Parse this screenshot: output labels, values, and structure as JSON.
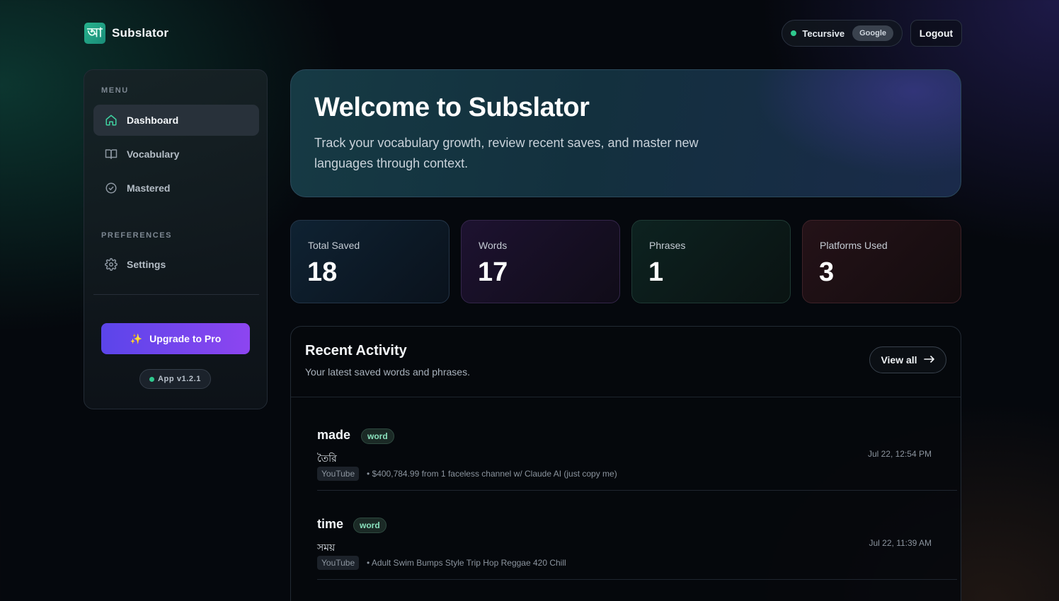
{
  "app": {
    "name": "Subslator",
    "logo_glyph": "আ"
  },
  "header": {
    "user_name": "Tecursive",
    "auth_provider": "Google",
    "logout_label": "Logout",
    "status_color": "#2fc98e"
  },
  "sidebar": {
    "menu_title": "MENU",
    "items": [
      {
        "label": "Dashboard",
        "icon": "home-icon",
        "active": true
      },
      {
        "label": "Vocabulary",
        "icon": "book-icon",
        "active": false
      },
      {
        "label": "Mastered",
        "icon": "check-circle-icon",
        "active": false
      }
    ],
    "preferences_title": "PREFERENCES",
    "preferences": [
      {
        "label": "Settings",
        "icon": "gear-icon"
      }
    ],
    "upgrade_label": "Upgrade to Pro",
    "upgrade_icon": "sparkles-icon",
    "version_label": "App v1.2.1"
  },
  "welcome": {
    "title": "Welcome to Subslator",
    "subtitle": "Track your vocabulary growth, review recent saves, and master new languages through context."
  },
  "stats": [
    {
      "label": "Total Saved",
      "value": "18"
    },
    {
      "label": "Words",
      "value": "17"
    },
    {
      "label": "Phrases",
      "value": "1"
    },
    {
      "label": "Platforms Used",
      "value": "3"
    }
  ],
  "activity": {
    "title": "Recent Activity",
    "subtitle": "Your latest saved words and phrases.",
    "view_all_label": "View all",
    "view_all_icon": "arrow-right-icon",
    "entries": [
      {
        "word": "made",
        "type": "word",
        "translation": "তৈরি",
        "platform": "YouTube",
        "source": "• $400,784.99 from 1 faceless channel w/ Claude AI (just copy me)",
        "date": "Jul 22, 12:54 PM"
      },
      {
        "word": "time",
        "type": "word",
        "translation": "সময়",
        "platform": "YouTube",
        "source": "• Adult Swim Bumps Style Trip Hop Reggae 420 Chill",
        "date": "Jul 22, 11:39 AM"
      }
    ]
  }
}
